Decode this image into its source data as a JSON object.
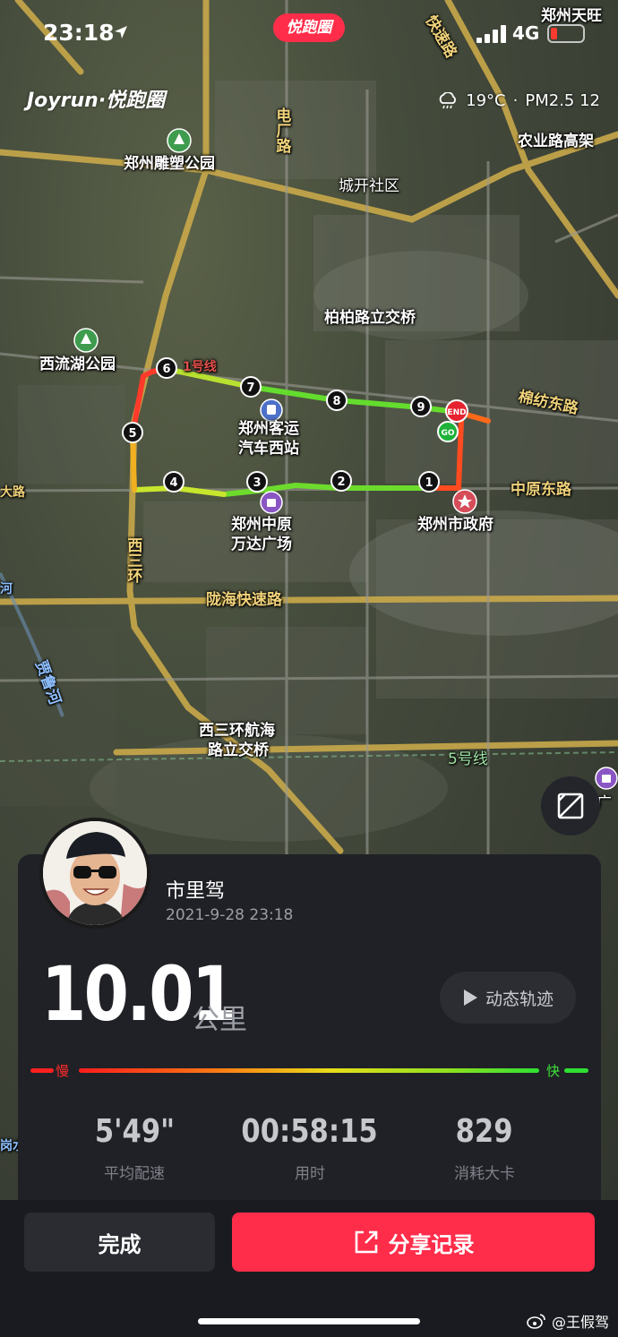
{
  "status_bar": {
    "time": "23:18",
    "app_badge": "悦跑圈",
    "network": "4G"
  },
  "map_header": {
    "brand": "Joyrun·悦跑圈",
    "temperature": "19°C",
    "separator": "·",
    "air_quality": "PM2.5 12"
  },
  "map": {
    "labels": {
      "zhengzhou_tianwang": "郑州天旺",
      "kuaisu_lu": "快速路",
      "nongye_lu": "农业路高架",
      "diaosu_park": "郑州雕塑公园",
      "chengkai": "城开社区",
      "dianchang_lu": "电厂路",
      "bobai_bridge": "柏柏路立交桥",
      "xiliuhu_park": "西流湖公园",
      "line1": "1号线",
      "bus_station_1": "郑州客运",
      "bus_station_2": "汽车西站",
      "mianfang_lu": "棉纺东路",
      "zhongyuan_dong": "中原东路",
      "wanda_1": "郑州中原",
      "wanda_2": "万达广场",
      "city_gov": "郑州市政府",
      "xisanhuan": "西三环",
      "longhai": "陇海快速路",
      "jialu_river": "贾鲁河",
      "hanghai_1": "西三环航海",
      "hanghai_2": "路立交桥",
      "line5": "5号线",
      "wanda_right": "万达广",
      "left_road": "大路",
      "left_river": "河",
      "left_bottom": "岗水"
    },
    "markers": [
      "1",
      "2",
      "3",
      "4",
      "5",
      "6",
      "7",
      "8",
      "9"
    ],
    "start_label": "GO",
    "end_label": "END"
  },
  "user": {
    "name": "市里驾",
    "datetime": "2021-9-28 23:18"
  },
  "summary": {
    "distance": "10.01",
    "distance_unit": "公里",
    "replay_label": "动态轨迹",
    "pace_slow": "慢",
    "pace_fast": "快"
  },
  "stats": [
    {
      "value": "5'49\"",
      "label": "平均配速"
    },
    {
      "value": "00:58:15",
      "label": "用时"
    },
    {
      "value": "829",
      "label": "消耗大卡"
    }
  ],
  "actions": {
    "done": "完成",
    "share": "分享记录"
  },
  "watermark": "@王假驾",
  "colors": {
    "accent": "#ff2d4a",
    "card": "#202126",
    "slow": "#ff2a2a",
    "fast": "#3ee33a"
  }
}
